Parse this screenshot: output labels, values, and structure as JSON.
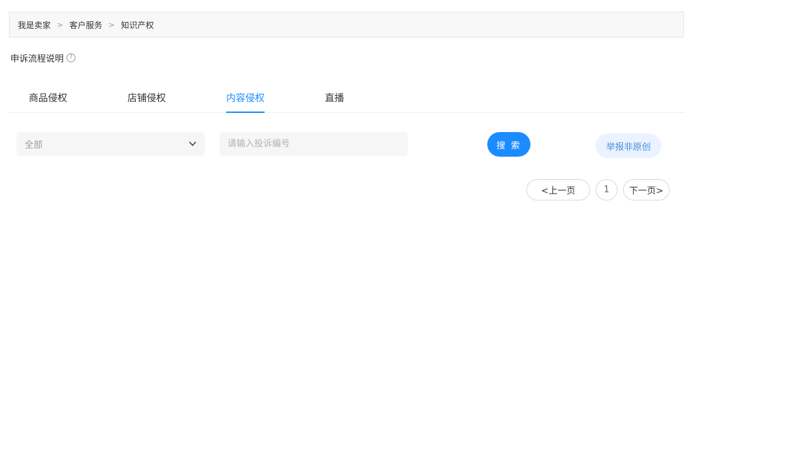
{
  "breadcrumb": {
    "items": [
      "我是卖家",
      "客户服务",
      "知识产权"
    ],
    "separator": ">"
  },
  "process": {
    "label": "申诉流程说明",
    "help_glyph": "?"
  },
  "tabs": [
    {
      "label": "商品侵权",
      "active": false
    },
    {
      "label": "店铺侵权",
      "active": false
    },
    {
      "label": "内容侵权",
      "active": true
    },
    {
      "label": "直播",
      "active": false
    }
  ],
  "filter": {
    "select_value": "全部",
    "search_placeholder": "请输入投诉编号",
    "search_value": "",
    "search_button": "搜 索",
    "report_button": "举报非原创"
  },
  "pagination": {
    "prev_label": "<上一页",
    "current_page": "1",
    "next_label": "下一页>"
  },
  "colors": {
    "accent": "#1a8cff",
    "report_bg": "#eaf3ff",
    "report_text": "#4a8fe0"
  },
  "icons": {
    "help": "question-circle-icon",
    "dropdown": "chevron-down-icon"
  }
}
